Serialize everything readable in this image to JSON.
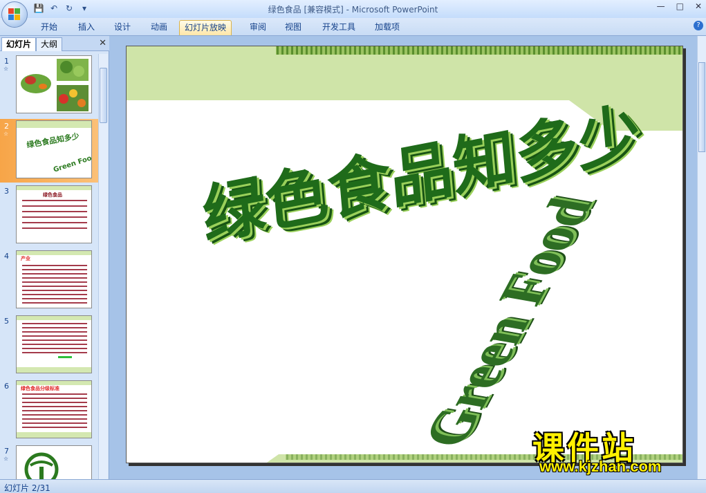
{
  "window": {
    "title": "绿色食品 [兼容模式] - Microsoft PowerPoint",
    "controls": [
      "—",
      "□",
      "✕"
    ]
  },
  "qat": {
    "save_icon": "💾",
    "undo_icon": "↶",
    "redo_icon": "↻",
    "more_icon": "▾"
  },
  "ribbon": {
    "tabs": [
      {
        "label": "开始"
      },
      {
        "label": "插入"
      },
      {
        "label": "设计"
      },
      {
        "label": "动画"
      },
      {
        "label": "幻灯片放映"
      },
      {
        "label": "审阅"
      },
      {
        "label": "视图"
      },
      {
        "label": "开发工具"
      },
      {
        "label": "加载项"
      }
    ],
    "active_tab": "幻灯片放映",
    "help": "?"
  },
  "left_panel": {
    "tabs": [
      {
        "label": "幻灯片"
      },
      {
        "label": "大纲"
      }
    ],
    "close": "✕",
    "slides": [
      {
        "num": "1",
        "star": "☆"
      },
      {
        "num": "2",
        "star": "☆"
      },
      {
        "num": "3",
        "star": ""
      },
      {
        "num": "4",
        "star": ""
      },
      {
        "num": "5",
        "star": ""
      },
      {
        "num": "6",
        "star": ""
      },
      {
        "num": "7",
        "star": "☆"
      }
    ],
    "slide2_thumb": {
      "cn": "绿色食品知多少",
      "en": "Green Food"
    },
    "slide3_title": "绿色食品",
    "slide4_title": "产业",
    "slide6_title": "绿色食品分级标准"
  },
  "slide": {
    "title_cn": "绿色食品知多少",
    "title_en": "Green Food"
  },
  "status": {
    "slide_counter": "幻灯片 2/31"
  },
  "watermark": {
    "cn": "课件站",
    "url": "www.kjzhan.com"
  },
  "colors": {
    "title_green": "#1f6b1a",
    "title_highlight": "#9ad05a",
    "band_green": "#cfe4a8",
    "stripe_green": "#4f8f2a"
  }
}
